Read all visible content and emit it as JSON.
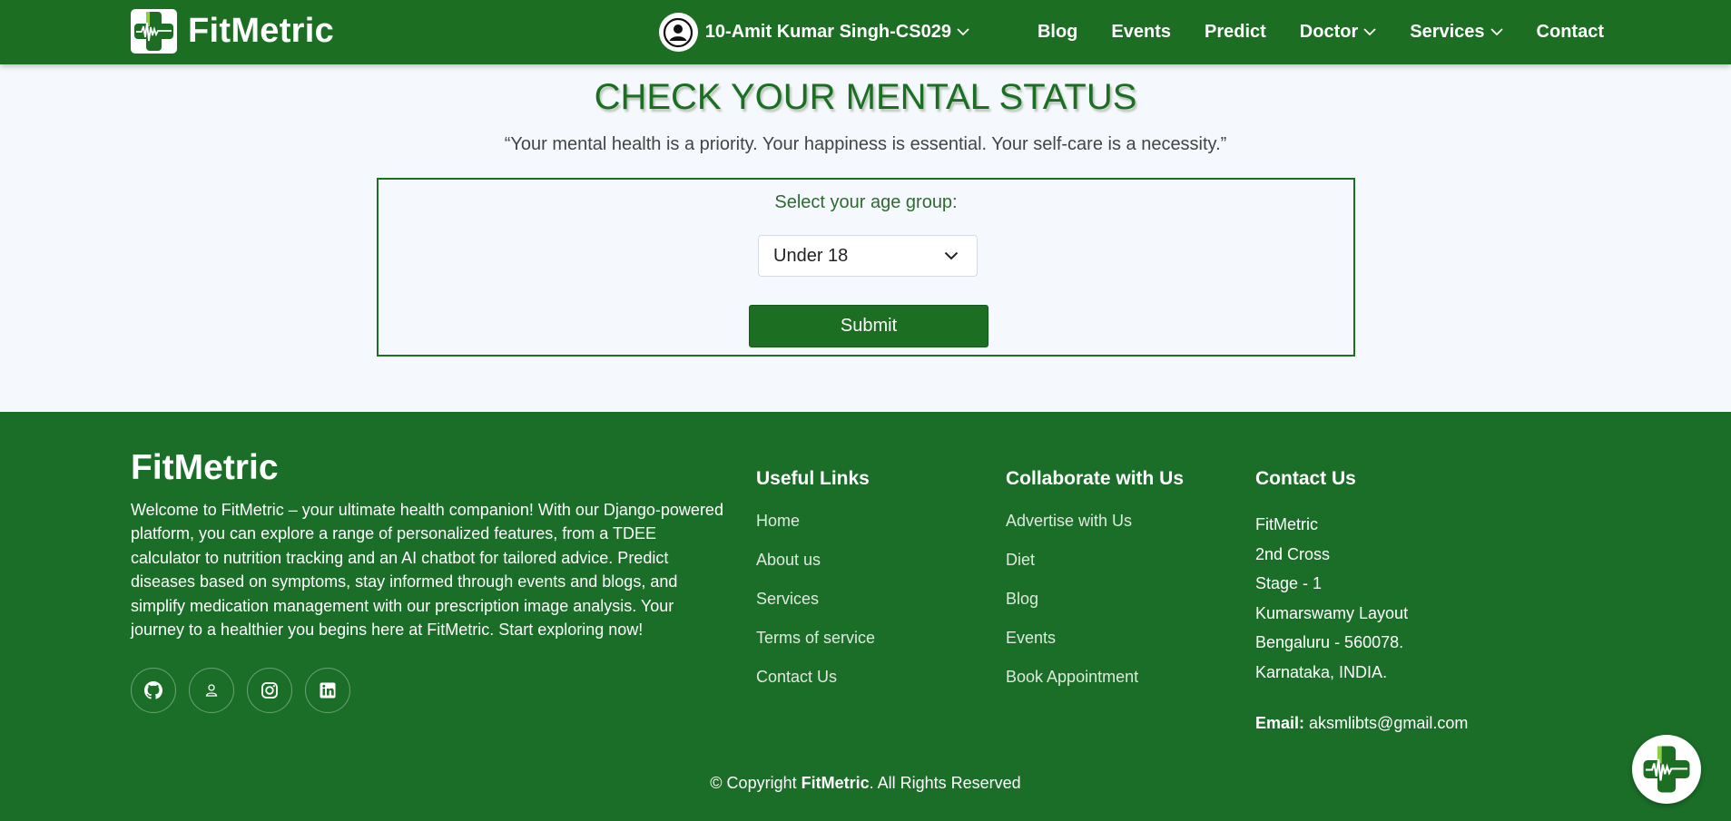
{
  "colors": {
    "brand_green": "#1b6e22",
    "footer_green": "#1b6e28",
    "page_bg": "#f5f8fd",
    "logo_light_green": "#8ccd4a"
  },
  "header": {
    "brand": "FitMetric",
    "logo_icon": "medical-cross-heartbeat-icon",
    "user": {
      "name": "10-Amit Kumar Singh-CS029",
      "icon": "user-circle-icon",
      "has_dropdown": true
    },
    "nav": [
      {
        "label": "Blog",
        "has_dropdown": false
      },
      {
        "label": "Events",
        "has_dropdown": false
      },
      {
        "label": "Predict",
        "has_dropdown": false
      },
      {
        "label": "Doctor",
        "has_dropdown": true
      },
      {
        "label": "Services",
        "has_dropdown": true
      },
      {
        "label": "Contact",
        "has_dropdown": false
      }
    ]
  },
  "main": {
    "title": "CHECK YOUR MENTAL STATUS",
    "quote": "“Your mental health is a priority. Your happiness is essential. Your self-care is a necessity.”",
    "form": {
      "label": "Select your age group:",
      "selected_age_group": "Under 18",
      "submit_label": "Submit"
    }
  },
  "footer": {
    "brand": "FitMetric",
    "description": "Welcome to FitMetric – your ultimate health companion! With our Django-powered platform, you can explore a range of personalized features, from a TDEE calculator to nutrition tracking and an AI chatbot for tailored advice. Predict diseases based on symptoms, stay informed through events and blogs, and simplify medication management with our prescription image analysis. Your journey to a healthier you begins here at FitMetric. Start exploring now!",
    "socials": [
      "github-icon",
      "person-icon",
      "instagram-icon",
      "linkedin-icon"
    ],
    "useful_links": {
      "heading": "Useful Links",
      "items": [
        "Home",
        "About us",
        "Services",
        "Terms of service",
        "Contact Us"
      ]
    },
    "collaborate": {
      "heading": "Collaborate with Us",
      "items": [
        "Advertise with Us",
        "Diet",
        "Blog",
        "Events",
        "Book Appointment"
      ]
    },
    "contact": {
      "heading": "Contact Us",
      "lines": [
        "FitMetric",
        "2nd Cross",
        "Stage - 1",
        "Kumarswamy Layout",
        "Bengaluru - 560078.",
        "Karnataka, INDIA."
      ],
      "email_label": "Email:",
      "email": "aksmlibts@gmail.com"
    },
    "copyright": {
      "prefix": "© Copyright ",
      "brand": "FitMetric",
      "suffix": ". All Rights Reserved"
    }
  },
  "chat_fab": {
    "icon": "chatbot-logo-icon"
  }
}
